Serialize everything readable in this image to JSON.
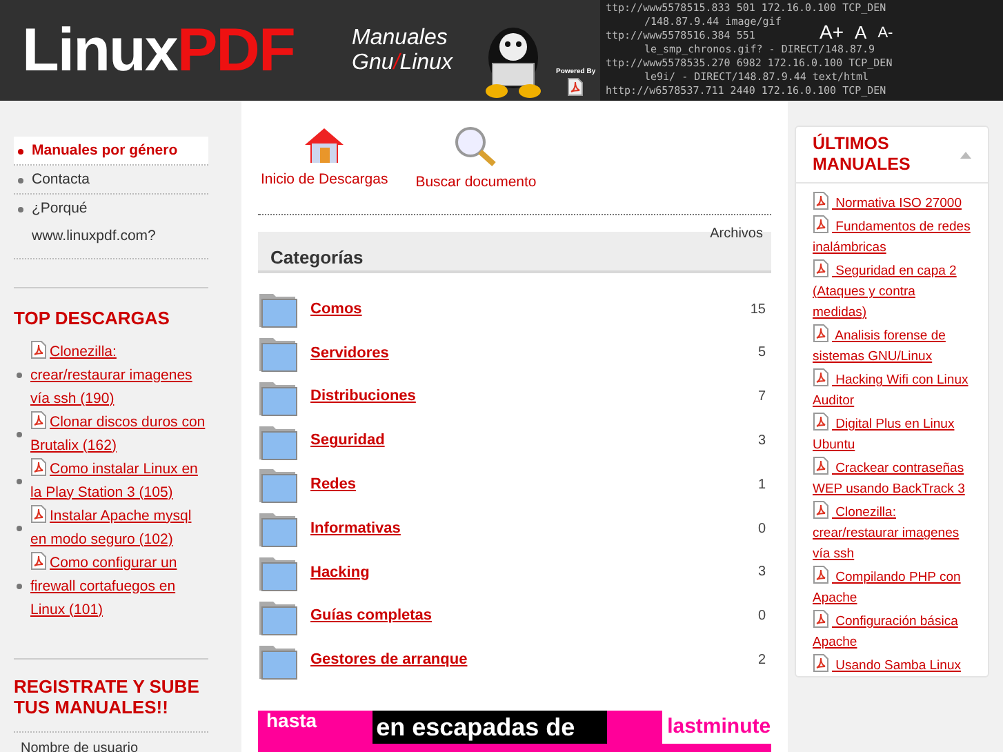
{
  "header": {
    "logo_left": "Linux",
    "logo_right": "PDF",
    "tagline_1": "Manuales",
    "tagline_2a": "Gnu",
    "tagline_sep": "/",
    "tagline_2b": "Linux",
    "powered": "Powered By",
    "log_lines": [
      "ttp://www5578515.833    501 172.16.0.100 TCP_DEN",
      "/148.87.9.44 image/gif",
      "ttp://www5578516.384    551",
      "le_smp_chronos.gif? - DIRECT/148.87.9",
      "ttp://www5578535.270   6982 172.16.0.100 TCP_DEN",
      "le9i/ - DIRECT/148.87.9.44 text/html",
      "http://w6578537.711   2440 172.16.0.100 TCP_DEN"
    ],
    "font_buttons": [
      "A+",
      "A",
      "A-"
    ]
  },
  "left_nav": [
    {
      "label": "Manuales por género",
      "selected": true
    },
    {
      "label": "Contacta",
      "selected": false
    },
    {
      "label": "¿Porqué www.linuxpdf.com?",
      "selected": false
    }
  ],
  "top_downloads": {
    "title": "TOP DESCARGAS",
    "items": [
      "Clonezilla: crear/restaurar imagenes vía ssh (190)",
      "Clonar discos duros con Brutalix (162)",
      "Como instalar Linux en la Play Station 3 (105)",
      "Instalar Apache mysql en modo seguro (102)",
      "Como configurar un firewall cortafuegos en Linux (101)"
    ]
  },
  "register": {
    "title": "REGISTRATE Y SUBE TUS MANUALES!!",
    "username_label": "Nombre de usuario"
  },
  "toolbar": [
    {
      "kind": "home",
      "label": "Inicio de Descargas"
    },
    {
      "kind": "search",
      "label": "Buscar documento"
    }
  ],
  "categories": {
    "title": "Categorías",
    "files_header": "Archivos",
    "rows": [
      {
        "name": "Comos",
        "count": "15"
      },
      {
        "name": "Servidores",
        "count": "5"
      },
      {
        "name": "Distribuciones",
        "count": "7"
      },
      {
        "name": "Seguridad",
        "count": "3"
      },
      {
        "name": "Redes",
        "count": "1"
      },
      {
        "name": "Informativas",
        "count": "0"
      },
      {
        "name": "Hacking",
        "count": "3"
      },
      {
        "name": "Guías completas",
        "count": "0"
      },
      {
        "name": "Gestores de arranque",
        "count": "2"
      }
    ]
  },
  "banner": {
    "text_1": "hasta",
    "text_2": "en escapadas de",
    "text_3": "lastminute"
  },
  "latest": {
    "title": "ÚLTIMOS MANUALES",
    "expanded": true,
    "items": [
      "Normativa ISO 27000",
      "Fundamentos de redes inalámbricas",
      "Seguridad en capa 2 (Ataques y contra medidas)",
      "Analisis forense de sistemas GNU/Linux",
      "Hacking Wifi con Linux Auditor",
      "Digital Plus en Linux Ubuntu",
      "Crackear contraseñas WEP usando BackTrack 3",
      "Clonezilla: crear/restaurar imagenes vía ssh",
      "Compilando PHP con Apache",
      "Configuración básica Apache",
      "Usando Samba Linux"
    ]
  }
}
